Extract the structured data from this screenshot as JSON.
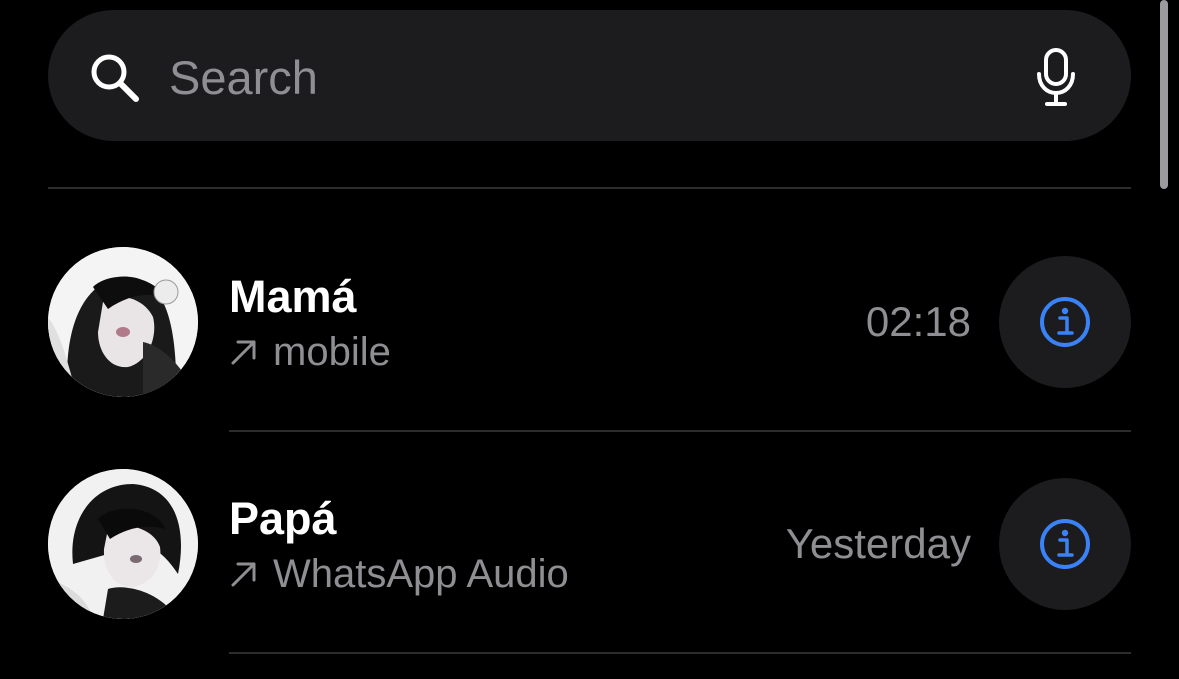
{
  "search": {
    "placeholder": "Search",
    "icon": "search-icon",
    "mic_icon": "microphone-icon"
  },
  "calls": [
    {
      "name": "Mamá",
      "direction_icon": "outgoing-arrow-icon",
      "type": "mobile",
      "time": "02:18",
      "info_icon": "info-icon"
    },
    {
      "name": "Papá",
      "direction_icon": "outgoing-arrow-icon",
      "type": "WhatsApp Audio",
      "time": "Yesterday",
      "info_icon": "info-icon"
    }
  ],
  "colors": {
    "background": "#000000",
    "surface": "#1c1c1e",
    "secondary_text": "#8e8e93",
    "accent": "#3a82f7",
    "divider": "#2c2c2e"
  }
}
